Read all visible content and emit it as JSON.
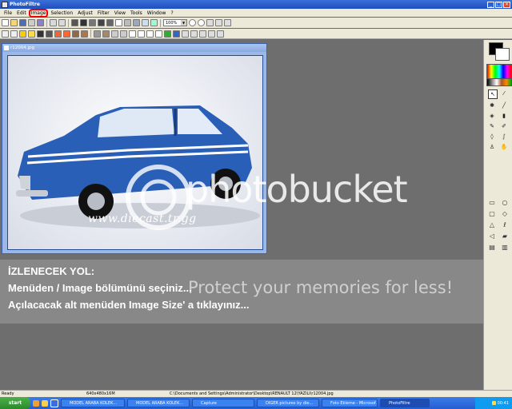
{
  "titlebar": {
    "title": "PhotoFiltre"
  },
  "menubar": {
    "items": [
      "File",
      "Edit",
      "Image",
      "Selection",
      "Adjust",
      "Filter",
      "View",
      "Tools",
      "Window",
      "?"
    ],
    "highlighted": "Image"
  },
  "toolbar": {
    "zoom_value": "100%"
  },
  "image_window": {
    "title": "r12004.jpg",
    "caption": "www.diecast.tr.gg"
  },
  "watermark": {
    "text": "photobucket",
    "ad_text": "Protect your memories for less!"
  },
  "overlay": {
    "line1": "İZLENECEK YOL:",
    "line2": "Menüden / Image bölümünü seçiniz...",
    "line3": "Açılacacak alt menüden Image Size' a tıklayınız..."
  },
  "statusbar": {
    "ready": "Ready",
    "dimensions": "640x480x16M",
    "path": "C:\\Documents and Settings\\Administrator\\Desktop\\RENAULT 12\\YAZILI\\r12004.jpg"
  },
  "taskbar": {
    "start_label": "start",
    "tasks": [
      "MODEL ARABA KOLEK...",
      "MODEL ARABA KOLEK...",
      "Capture",
      "DIGER pictures by die...",
      "Foto Ekleme - Microsof...",
      "PhotoFiltre"
    ],
    "clock": "00:41"
  },
  "colors": {
    "car_blue": "#2a5fb8",
    "overlay_text": "#ffffff",
    "highlight_red": "#e00000"
  }
}
